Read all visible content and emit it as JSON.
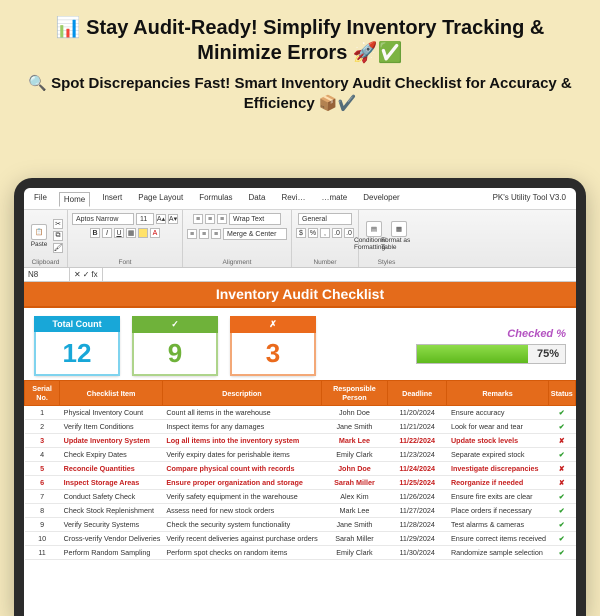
{
  "hero": {
    "line1": "📊 Stay Audit-Ready! Simplify Inventory Tracking & Minimize Errors 🚀✅",
    "line2": "🔍 Spot Discrepancies Fast! Smart Inventory Audit Checklist for Accuracy & Efficiency 📦✔️"
  },
  "excel": {
    "menu": [
      "File",
      "Home",
      "Insert",
      "Page Layout",
      "Formulas",
      "Data",
      "Revi…",
      "…mate",
      "Developer"
    ],
    "menu_right": "PK's Utility Tool V3.0",
    "ribbon": {
      "clipboard": {
        "paste": "Paste",
        "label": "Clipboard"
      },
      "font": {
        "name": "Aptos Narrow",
        "size": "11",
        "label": "Font"
      },
      "alignment": {
        "wrap": "Wrap Text",
        "merge": "Merge & Center",
        "label": "Alignment"
      },
      "number": {
        "format": "General",
        "label": "Number"
      },
      "styles": {
        "cond": "Conditional Formatting",
        "fmt": "Format as Table",
        "label": "Styles"
      }
    },
    "namebox": "N8",
    "fx_placeholder": "fx"
  },
  "sheet": {
    "title": "Inventory Audit Checklist",
    "cards": {
      "total": {
        "label": "Total Count",
        "value": "12"
      },
      "done": {
        "label": "✓",
        "value": "9"
      },
      "fail": {
        "label": "✗",
        "value": "3"
      }
    },
    "checked": {
      "caption": "Checked %",
      "percent": "75%",
      "bar_pct": 75
    },
    "columns": [
      "Serial No.",
      "Checklist Item",
      "Description",
      "Responsible Person",
      "Deadline",
      "Remarks",
      "Status"
    ],
    "rows": [
      {
        "n": "1",
        "item": "Physical Inventory Count",
        "desc": "Count all items in the warehouse",
        "who": "John Doe",
        "date": "11/20/2024",
        "rem": "Ensure accuracy",
        "ok": true,
        "red": false
      },
      {
        "n": "2",
        "item": "Verify Item Conditions",
        "desc": "Inspect items for any damages",
        "who": "Jane Smith",
        "date": "11/21/2024",
        "rem": "Look for wear and tear",
        "ok": true,
        "red": false
      },
      {
        "n": "3",
        "item": "Update Inventory System",
        "desc": "Log all items into the inventory system",
        "who": "Mark Lee",
        "date": "11/22/2024",
        "rem": "Update stock levels",
        "ok": false,
        "red": true
      },
      {
        "n": "4",
        "item": "Check Expiry Dates",
        "desc": "Verify expiry dates for perishable items",
        "who": "Emily Clark",
        "date": "11/23/2024",
        "rem": "Separate expired stock",
        "ok": true,
        "red": false
      },
      {
        "n": "5",
        "item": "Reconcile Quantities",
        "desc": "Compare physical count with records",
        "who": "John Doe",
        "date": "11/24/2024",
        "rem": "Investigate discrepancies",
        "ok": false,
        "red": true
      },
      {
        "n": "6",
        "item": "Inspect Storage Areas",
        "desc": "Ensure proper organization and storage",
        "who": "Sarah Miller",
        "date": "11/25/2024",
        "rem": "Reorganize if needed",
        "ok": false,
        "red": true
      },
      {
        "n": "7",
        "item": "Conduct Safety Check",
        "desc": "Verify safety equipment in the warehouse",
        "who": "Alex Kim",
        "date": "11/26/2024",
        "rem": "Ensure fire exits are clear",
        "ok": true,
        "red": false
      },
      {
        "n": "8",
        "item": "Check Stock Replenishment",
        "desc": "Assess need for new stock orders",
        "who": "Mark Lee",
        "date": "11/27/2024",
        "rem": "Place orders if necessary",
        "ok": true,
        "red": false
      },
      {
        "n": "9",
        "item": "Verify Security Systems",
        "desc": "Check the security system functionality",
        "who": "Jane Smith",
        "date": "11/28/2024",
        "rem": "Test alarms & cameras",
        "ok": true,
        "red": false
      },
      {
        "n": "10",
        "item": "Cross-verify Vendor Deliveries",
        "desc": "Verify recent deliveries against purchase orders",
        "who": "Sarah Miller",
        "date": "11/29/2024",
        "rem": "Ensure correct items received",
        "ok": true,
        "red": false
      },
      {
        "n": "11",
        "item": "Perform Random Sampling",
        "desc": "Perform spot checks on random items",
        "who": "Emily Clark",
        "date": "11/30/2024",
        "rem": "Randomize sample selection",
        "ok": true,
        "red": false
      }
    ]
  }
}
